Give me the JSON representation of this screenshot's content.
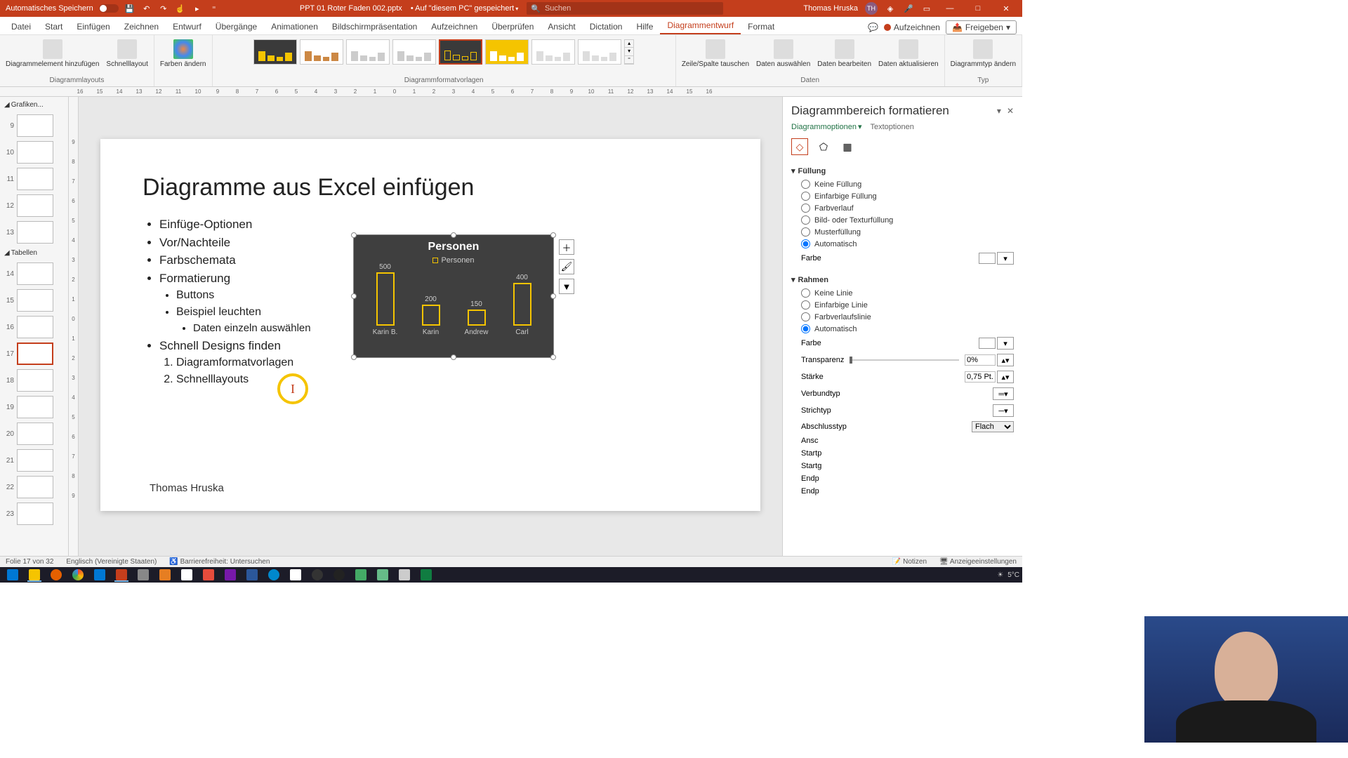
{
  "titlebar": {
    "autosave": "Automatisches Speichern",
    "filename": "PPT 01 Roter Faden 002.pptx",
    "saved_loc": "• Auf \"diesem PC\" gespeichert",
    "search_placeholder": "Suchen",
    "user": "Thomas Hruska",
    "user_initials": "TH"
  },
  "tabs": [
    "Datei",
    "Start",
    "Einfügen",
    "Zeichnen",
    "Entwurf",
    "Übergänge",
    "Animationen",
    "Bildschirmpräsentation",
    "Aufzeichnen",
    "Überprüfen",
    "Ansicht",
    "Dictation",
    "Hilfe",
    "Diagrammentwurf",
    "Format"
  ],
  "active_tab": 13,
  "ribbon_actions": {
    "record": "Aufzeichnen",
    "share": "Freigeben"
  },
  "ribbon_groups": {
    "layouts": {
      "label": "Diagrammlayouts",
      "add_element": "Diagrammelement hinzufügen",
      "quick_layout": "Schnelllayout"
    },
    "colors": {
      "change": "Farben ändern"
    },
    "styles": {
      "label": "Diagrammformatvorlagen"
    },
    "data": {
      "label": "Daten",
      "swap": "Zeile/Spalte tauschen",
      "select": "Daten auswählen",
      "edit": "Daten bearbeiten",
      "refresh": "Daten aktualisieren"
    },
    "type": {
      "label": "Typ",
      "change": "Diagrammtyp ändern"
    }
  },
  "thumbnails": {
    "section1": "Grafiken...",
    "section2": "Tabellen",
    "slides": [
      9,
      10,
      11,
      12,
      13,
      14,
      15,
      16,
      17,
      18,
      19,
      20,
      21,
      22,
      23
    ],
    "active": 17
  },
  "slide": {
    "title": "Diagramme aus Excel einfügen",
    "bullets": {
      "b1": "Einfüge-Optionen",
      "b2": "Vor/Nachteile",
      "b3": "Farbschemata",
      "b4": "Formatierung",
      "b4a": "Buttons",
      "b4b": "Beispiel leuchten",
      "b4b1": "Daten einzeln auswählen",
      "b5": "Schnell Designs finden",
      "b5_1": "Diagramformatvorlagen",
      "b5_2": "Schnelllayouts"
    },
    "author": "Thomas Hruska"
  },
  "chart_data": {
    "type": "bar",
    "title": "Personen",
    "legend": "Personen",
    "categories": [
      "Karin B.",
      "Karin",
      "Andrew",
      "Carl"
    ],
    "values": [
      500,
      200,
      150,
      400
    ],
    "ylim": [
      0,
      500
    ],
    "bar_outline": "#f5c400",
    "background": "#3f3f3f"
  },
  "format_pane": {
    "title": "Diagrammbereich formatieren",
    "tab_chart": "Diagrammoptionen",
    "tab_text": "Textoptionen",
    "fill": {
      "head": "Füllung",
      "none": "Keine Füllung",
      "solid": "Einfarbige Füllung",
      "gradient": "Farbverlauf",
      "picture": "Bild- oder Texturfüllung",
      "pattern": "Musterfüllung",
      "auto": "Automatisch",
      "color": "Farbe"
    },
    "border": {
      "head": "Rahmen",
      "none": "Keine Linie",
      "solid": "Einfarbige Linie",
      "gradient": "Farbverlaufslinie",
      "auto": "Automatisch",
      "color": "Farbe",
      "transparency": "Transparenz",
      "transparency_val": "0%",
      "width": "Stärke",
      "width_val": "0,75 Pt.",
      "compound": "Verbundtyp",
      "dash": "Strichtyp",
      "cap": "Abschlusstyp",
      "cap_val": "Flach",
      "join": "Ansc",
      "arrow_start": "Startp",
      "arrow_start2": "Startg",
      "arrow_end": "Endp",
      "arrow_end2": "Endp"
    }
  },
  "statusbar": {
    "slide": "Folie 17 von 32",
    "lang": "Englisch (Vereinigte Staaten)",
    "access": "Barrierefreiheit: Untersuchen",
    "notes": "Notizen",
    "display": "Anzeigeeinstellungen"
  },
  "tray": {
    "temp": "5°C"
  }
}
